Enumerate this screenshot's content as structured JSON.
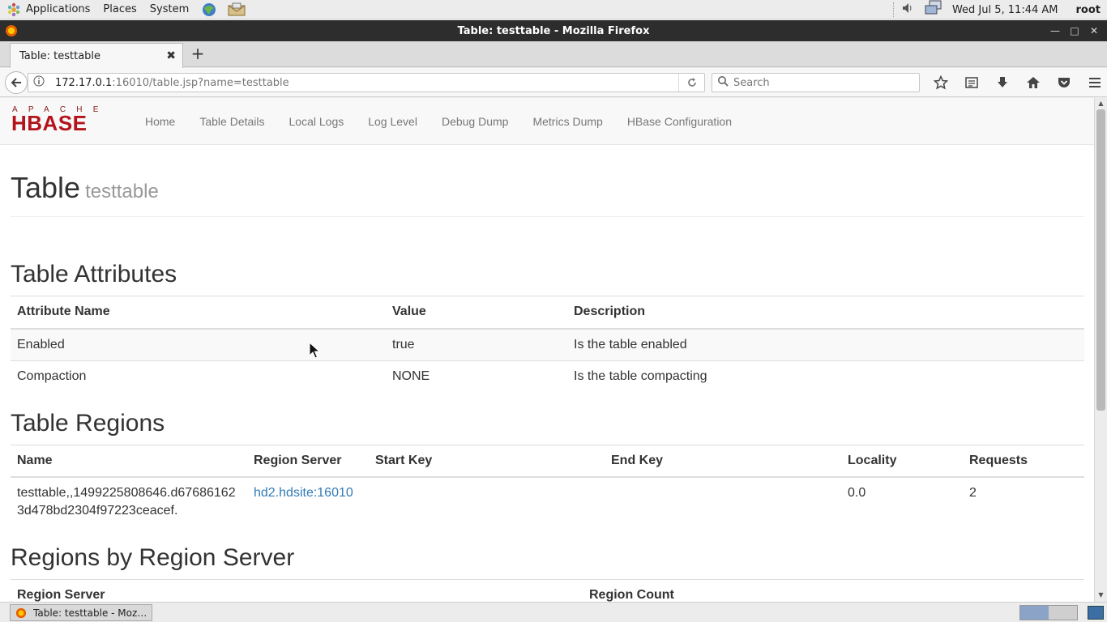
{
  "panel": {
    "applications": "Applications",
    "places": "Places",
    "system": "System",
    "clock": "Wed Jul  5, 11:44 AM",
    "user": "root"
  },
  "window": {
    "title": "Table: testtable - Mozilla Firefox"
  },
  "browser": {
    "tab_title": "Table: testtable",
    "url_host": "172.17.0.1",
    "url_rest": ":16010/table.jsp?name=testtable",
    "search_placeholder": "Search"
  },
  "hbase": {
    "nav": [
      "Home",
      "Table Details",
      "Local Logs",
      "Log Level",
      "Debug Dump",
      "Metrics Dump",
      "HBase Configuration"
    ],
    "title": "Table",
    "subtitle": "testtable",
    "attributes": {
      "heading": "Table Attributes",
      "headers": [
        "Attribute Name",
        "Value",
        "Description"
      ],
      "rows": [
        [
          "Enabled",
          "true",
          "Is the table enabled"
        ],
        [
          "Compaction",
          "NONE",
          "Is the table compacting"
        ]
      ]
    },
    "regions": {
      "heading": "Table Regions",
      "headers": [
        "Name",
        "Region Server",
        "Start Key",
        "End Key",
        "Locality",
        "Requests"
      ],
      "rows": [
        {
          "name": "testtable,,1499225808646.d67686162 3d478bd2304f97223ceacef.",
          "server": "hd2.hdsite:16010",
          "start_key": "",
          "end_key": "",
          "locality": "0.0",
          "requests": "2"
        }
      ]
    },
    "by_server": {
      "heading": "Regions by Region Server",
      "headers": [
        "Region Server",
        "Region Count"
      ]
    }
  },
  "taskbar": {
    "item": "Table: testtable - Moz…"
  }
}
